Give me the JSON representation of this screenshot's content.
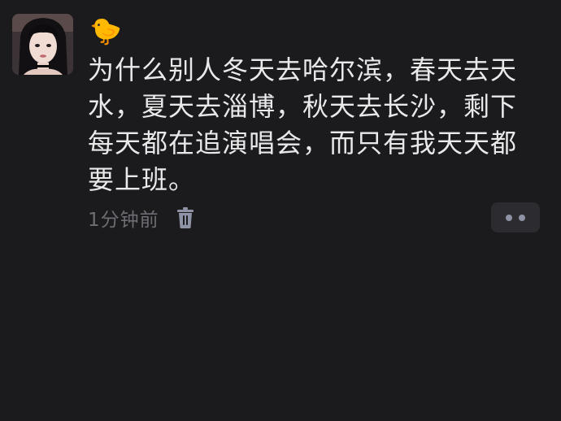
{
  "post": {
    "nickname": "🐤",
    "content": "为什么别人冬天去哈尔滨，春天去天水，夏天去淄博，秋天去长沙，剩下每天都在追演唱会，而只有我天天都要上班。",
    "timestamp": "1分钟前"
  },
  "icons": {
    "avatar": "avatar-photo",
    "delete": "trash-icon",
    "more": "more-dots-icon"
  },
  "colors": {
    "background": "#1b1a1d",
    "text": "#e9e9ea",
    "muted": "#6d6e73",
    "icon": "#8f93a6",
    "button_bg": "#2c2c30"
  }
}
